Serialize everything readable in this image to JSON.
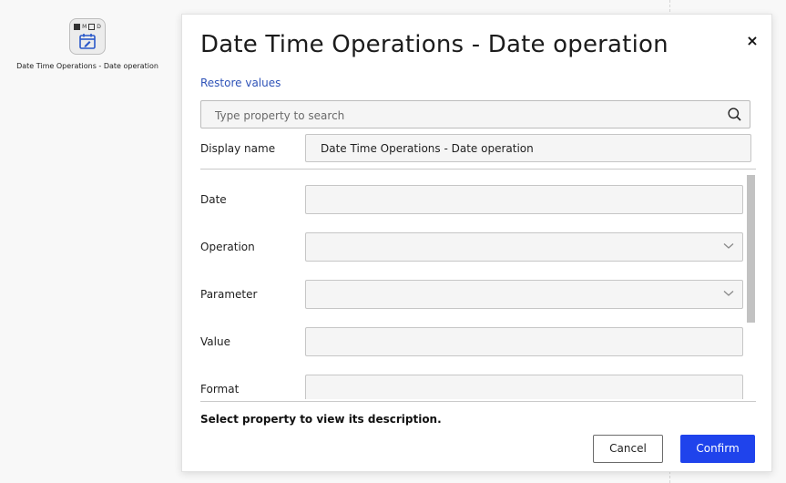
{
  "canvas": {
    "node": {
      "icon_name": "date-operation-icon",
      "mini_labels": [
        "M",
        "D"
      ],
      "label": "Date Time Operations - Date operation"
    }
  },
  "dialog": {
    "title": "Date Time Operations - Date operation",
    "close_label": "×",
    "restore_label": "Restore values",
    "search": {
      "placeholder": "Type property to search",
      "value": ""
    },
    "display_name": {
      "label": "Display name",
      "value": "Date Time Operations - Date operation"
    },
    "fields": [
      {
        "label": "Date",
        "type": "text",
        "value": ""
      },
      {
        "label": "Operation",
        "type": "select",
        "value": ""
      },
      {
        "label": "Parameter",
        "type": "select",
        "value": ""
      },
      {
        "label": "Value",
        "type": "text",
        "value": ""
      },
      {
        "label": "Format",
        "type": "text",
        "value": ""
      }
    ],
    "description": "Select property to view its description.",
    "cancel_label": "Cancel",
    "confirm_label": "Confirm"
  },
  "colors": {
    "accent": "#1f43ec",
    "link": "#2f53b8",
    "field_bg": "#f5f5f5",
    "canvas_bg": "#f8f8f8"
  }
}
